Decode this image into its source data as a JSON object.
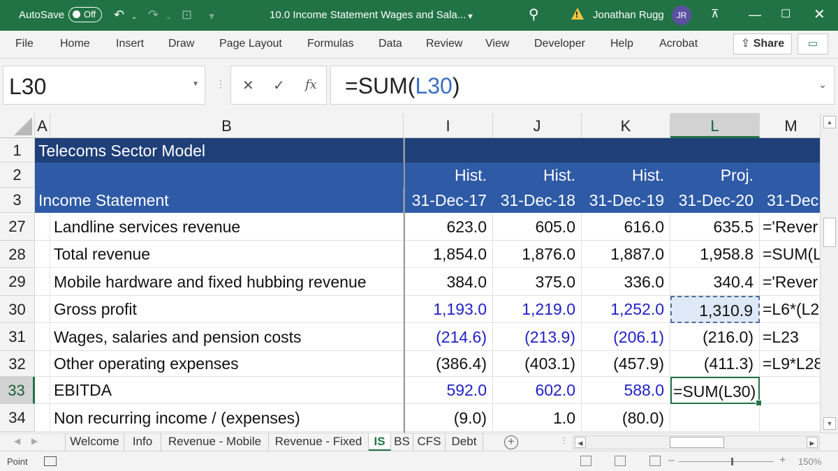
{
  "titlebar": {
    "autosave_label": "AutoSave",
    "autosave_state": "Off",
    "document_title": "10.0 Income Statement Wages and Sala...",
    "user_name": "Jonathan Rugg",
    "user_initials": "JR",
    "accent_color": "#217346"
  },
  "ribbon": {
    "tabs": [
      "File",
      "Home",
      "Insert",
      "Draw",
      "Page Layout",
      "Formulas",
      "Data",
      "Review",
      "View",
      "Developer",
      "Help",
      "Acrobat"
    ],
    "share_label": "Share"
  },
  "formula_bar": {
    "name_box": "L30",
    "fx_label": "fx",
    "formula_prefix": "=SUM(",
    "formula_ref": "L30",
    "formula_suffix": ")"
  },
  "columns": [
    "A",
    "B",
    "I",
    "J",
    "K",
    "L",
    "M"
  ],
  "selected_column": "L",
  "header_rows": {
    "r1": {
      "num": "1",
      "label": "Telecoms Sector Model"
    },
    "r2": {
      "num": "2",
      "I": "Hist.",
      "J": "Hist.",
      "K": "Hist.",
      "L": "Proj.",
      "M": "P"
    },
    "r3": {
      "num": "3",
      "label": "Income Statement",
      "I": "31-Dec-17",
      "J": "31-Dec-18",
      "K": "31-Dec-19",
      "L": "31-Dec-20",
      "M": "31-Dec"
    }
  },
  "rows": [
    {
      "num": "27",
      "label": "Landline services revenue",
      "I": "623.0",
      "J": "605.0",
      "K": "616.0",
      "L": "635.5",
      "M": "='Rever"
    },
    {
      "num": "28",
      "label": "Total revenue",
      "I": "1,854.0",
      "J": "1,876.0",
      "K": "1,887.0",
      "L": "1,958.8",
      "M": "=SUM(L"
    },
    {
      "num": "29",
      "label": "Mobile hardware and fixed hubbing revenue",
      "I": "384.0",
      "J": "375.0",
      "K": "336.0",
      "L": "340.4",
      "M": "='Rever"
    },
    {
      "num": "30",
      "label": "Gross profit",
      "I": "1,193.0",
      "J": "1,219.0",
      "K": "1,252.0",
      "L": "1,310.9",
      "M": "=L6*(L2"
    },
    {
      "num": "31",
      "label": "Wages, salaries and pension costs",
      "I": "(214.6)",
      "J": "(213.9)",
      "K": "(206.1)",
      "L": "(216.0)",
      "M": "=L23"
    },
    {
      "num": "32",
      "label": "Other operating expenses",
      "I": "(386.4)",
      "J": "(403.1)",
      "K": "(457.9)",
      "L": "(411.3)",
      "M": "=L9*L28"
    },
    {
      "num": "33",
      "label": "EBITDA",
      "I": "592.0",
      "J": "602.0",
      "K": "588.0",
      "L": "=SUM(L30)",
      "M": ""
    },
    {
      "num": "34",
      "label": "Non recurring income / (expenses)",
      "I": "(9.0)",
      "J": "1.0",
      "K": "(80.0)",
      "L": "",
      "M": ""
    }
  ],
  "sheet_tabs": [
    "Welcome",
    "Info",
    "Revenue - Mobile",
    "Revenue - Fixed",
    "IS",
    "BS",
    "CFS",
    "Debt"
  ],
  "active_sheet": "IS",
  "status": {
    "mode": "Point",
    "zoom": "150%"
  }
}
